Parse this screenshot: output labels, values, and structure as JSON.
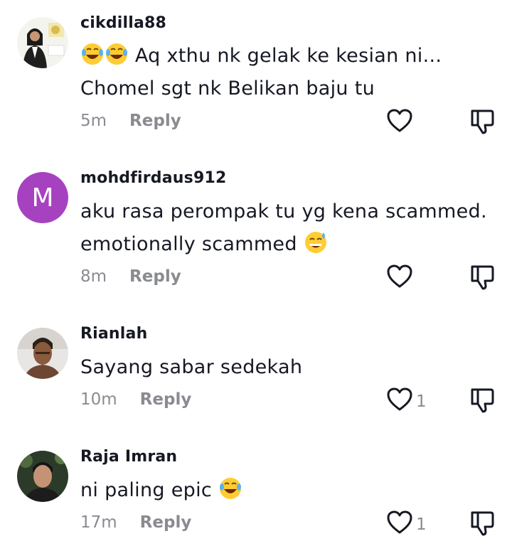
{
  "comments": [
    {
      "username": "cikdilla88",
      "avatar_type": "photo",
      "text_lines": [
        "Aq xthu nk gelak ke kesian ni...",
        "Chomel sgt nk Belikan baju tu"
      ],
      "leading_emojis": [
        "laughing-tears-emoji",
        "laughing-tears-emoji"
      ],
      "time": "5m",
      "reply_label": "Reply",
      "like_count": ""
    },
    {
      "username": "mohdfirdaus912",
      "avatar_type": "letter",
      "avatar_letter": "M",
      "avatar_color": "#a642c0",
      "text_lines": [
        "aku rasa perompak tu yg kena scammed.",
        "emotionally scammed"
      ],
      "trailing_emoji": "sweat-smile-emoji",
      "time": "8m",
      "reply_label": "Reply",
      "like_count": ""
    },
    {
      "username": "Rianlah",
      "avatar_type": "photo",
      "text_lines": [
        "Sayang sabar sedekah"
      ],
      "time": "10m",
      "reply_label": "Reply",
      "like_count": "1"
    },
    {
      "username": "Raja Imran",
      "avatar_type": "photo",
      "text_lines": [
        "ni paling epic"
      ],
      "trailing_emoji": "laughing-tears-emoji",
      "time": "17m",
      "reply_label": "Reply",
      "like_count": "1"
    }
  ],
  "colors": {
    "text": "#161823",
    "muted": "#8a8b91",
    "icon_stroke": "#161823"
  }
}
